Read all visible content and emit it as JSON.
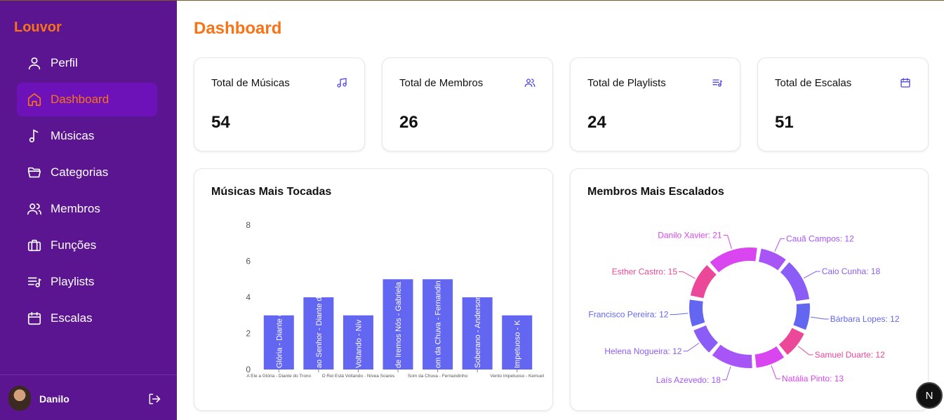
{
  "app": {
    "brand": "Louvor"
  },
  "sidebar": {
    "items": [
      {
        "label": "Perfil",
        "icon": "user-icon"
      },
      {
        "label": "Dashboard",
        "icon": "home-icon",
        "active": true
      },
      {
        "label": "Músicas",
        "icon": "music-note-icon"
      },
      {
        "label": "Categorias",
        "icon": "folder-icon"
      },
      {
        "label": "Membros",
        "icon": "users-icon"
      },
      {
        "label": "Funções",
        "icon": "briefcase-icon"
      },
      {
        "label": "Playlists",
        "icon": "playlist-icon"
      },
      {
        "label": "Escalas",
        "icon": "calendar-icon"
      }
    ],
    "user": {
      "name": "Danilo"
    }
  },
  "page": {
    "title": "Dashboard"
  },
  "stats": [
    {
      "label": "Total de Músicas",
      "value": "54",
      "icon": "music-icon"
    },
    {
      "label": "Total de Membros",
      "value": "26",
      "icon": "users-icon"
    },
    {
      "label": "Total de Playlists",
      "value": "24",
      "icon": "playlist-icon"
    },
    {
      "label": "Total de Escalas",
      "value": "51",
      "icon": "calendar-icon"
    }
  ],
  "charts": {
    "bar_title": "Músicas Mais Tocadas",
    "donut_title": "Membros Mais Escalados"
  },
  "chart_data": [
    {
      "type": "bar",
      "categories": [
        "A Ele a Glória - Diante do Trono",
        "Aclame ao Senhor - Diante do Trono",
        "O Rei Está Voltando - Nívea Soares",
        "Onde Iremos Nós - Gabriela Rocha",
        "Som da Chuva - Fernandinho",
        "Soberano - Anderson Freire",
        "Vento Impetuoso - Kemuel"
      ],
      "bar_labels": [
        "Glória - Diante d",
        "ao Senhor - Diante d",
        "Voltando - Nív",
        "de Iremos Nós - Gabriela",
        "om da Chuva - Fernandin",
        "Soberano - Anderson",
        "Impetuoso - K"
      ],
      "tick_labels": [
        "A Ele a Glória - Diante do Trono",
        "O Rei Está Voltando - Nívea Soares",
        "Som da Chuva - Fernandinho",
        "Vento Impetuoso - Kemuel"
      ],
      "values": [
        3,
        4,
        3,
        5,
        5,
        4,
        3
      ],
      "ylim": [
        0,
        8
      ],
      "yticks": [
        0,
        2,
        4,
        6,
        8
      ],
      "color": "#6366f1"
    },
    {
      "type": "pie",
      "style": "donut",
      "series": [
        {
          "label": "Cauã Campos: 12",
          "value": 12,
          "color": "#a855f7"
        },
        {
          "label": "Caio Cunha: 18",
          "value": 18,
          "color": "#8b5cf6"
        },
        {
          "label": "Bárbara Lopes: 12",
          "value": 12,
          "color": "#6366f1"
        },
        {
          "label": "Samuel Duarte: 12",
          "value": 12,
          "color": "#ec4899"
        },
        {
          "label": "Natália Pinto: 13",
          "value": 13,
          "color": "#d946ef"
        },
        {
          "label": "Laís Azevedo: 18",
          "value": 18,
          "color": "#a855f7"
        },
        {
          "label": "Helena Nogueira: 12",
          "value": 12,
          "color": "#8b5cf6"
        },
        {
          "label": "Francisco Pereira: 12",
          "value": 12,
          "color": "#6366f1"
        },
        {
          "label": "Esther Castro: 15",
          "value": 15,
          "color": "#ec4899"
        },
        {
          "label": "Danilo Xavier: 21",
          "value": 21,
          "color": "#d946ef"
        }
      ]
    }
  ],
  "colors": {
    "sidebar": "#5b1590",
    "accent": "#f97316",
    "active_bg": "#6d12b8"
  },
  "badge": {
    "label": "N"
  }
}
